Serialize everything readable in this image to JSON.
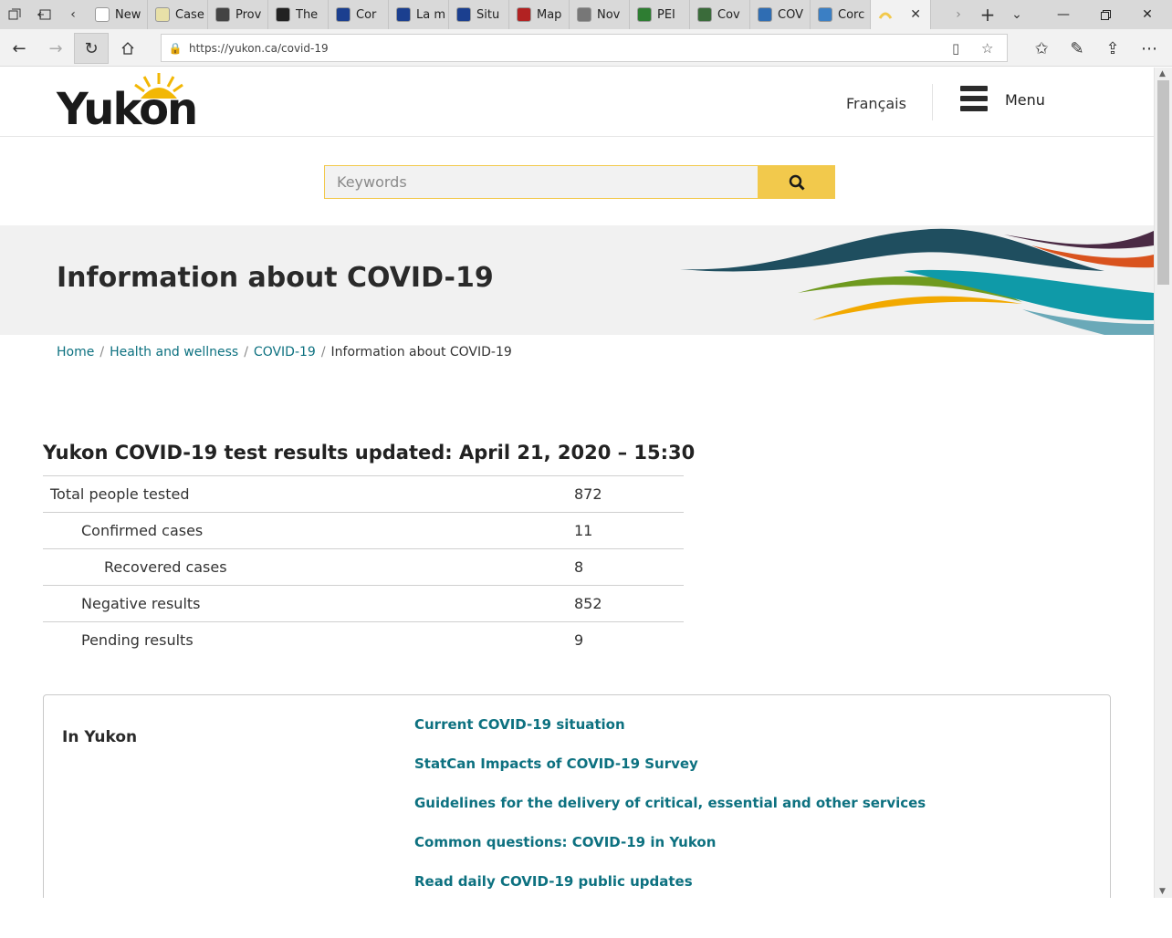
{
  "browser": {
    "tabs": [
      {
        "label": "New",
        "color": "#ffffff"
      },
      {
        "label": "Case",
        "color": "#e8e0a8"
      },
      {
        "label": "Prov",
        "color": "#444444"
      },
      {
        "label": "The",
        "color": "#222222"
      },
      {
        "label": "Cor",
        "color": "#1b3f8f"
      },
      {
        "label": "La m",
        "color": "#1b3f8f"
      },
      {
        "label": "Situ",
        "color": "#1b3f8f"
      },
      {
        "label": "Map",
        "color": "#b22222"
      },
      {
        "label": "Nov",
        "color": "#777777"
      },
      {
        "label": "PEI",
        "color": "#2e7d32"
      },
      {
        "label": "Cov",
        "color": "#3a6b3a"
      },
      {
        "label": "COV",
        "color": "#2f6db3"
      },
      {
        "label": "Corc",
        "color": "#3b7fc4"
      }
    ],
    "active_tab_color": "#f2c94c",
    "url": "https://yukon.ca/covid-19"
  },
  "header": {
    "logo_text": "Yukon",
    "language_link": "Français",
    "menu_label": "Menu"
  },
  "search": {
    "placeholder": "Keywords"
  },
  "hero": {
    "title": "Information about COVID-19"
  },
  "breadcrumb": {
    "home": "Home",
    "health": "Health and wellness",
    "covid": "COVID-19",
    "current": "Information about COVID-19",
    "separator": "/"
  },
  "results": {
    "title": "Yukon COVID-19 test results updated: April 21, 2020 – 15:30",
    "rows": [
      {
        "label": "Total people tested",
        "value": "872"
      },
      {
        "label": "Confirmed cases",
        "value": "11"
      },
      {
        "label": "Recovered cases",
        "value": "8"
      },
      {
        "label": "Negative results",
        "value": "852"
      },
      {
        "label": "Pending results",
        "value": "9"
      }
    ]
  },
  "in_yukon": {
    "heading": "In Yukon",
    "links": [
      "Current COVID-19 situation",
      "StatCan Impacts of COVID-19 Survey",
      "Guidelines for the delivery of critical, essential and other services",
      "Common questions: COVID-19 in Yukon",
      "Read daily COVID-19 public updates"
    ]
  },
  "colors": {
    "link": "#0d7180",
    "accent": "#f2c94c"
  }
}
